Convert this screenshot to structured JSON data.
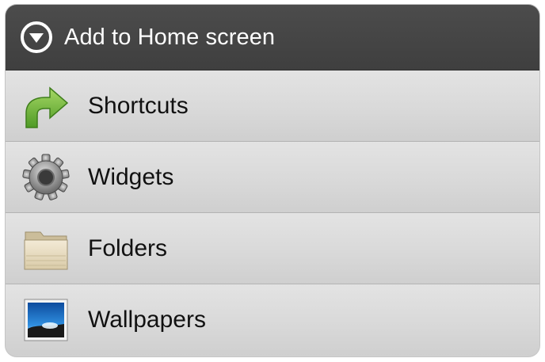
{
  "dialog": {
    "title": "Add to Home screen",
    "title_icon": "chevron-down-circle-icon"
  },
  "items": [
    {
      "label": "Shortcuts",
      "icon": "shortcut-arrow-icon"
    },
    {
      "label": "Widgets",
      "icon": "gear-icon"
    },
    {
      "label": "Folders",
      "icon": "folder-icon"
    },
    {
      "label": "Wallpapers",
      "icon": "wallpaper-picture-icon"
    }
  ],
  "colors": {
    "header_bg": "#444444",
    "item_bg": "#dcdcdc",
    "divider": "#b3b3b3",
    "shortcut_green": "#6fb13a"
  }
}
